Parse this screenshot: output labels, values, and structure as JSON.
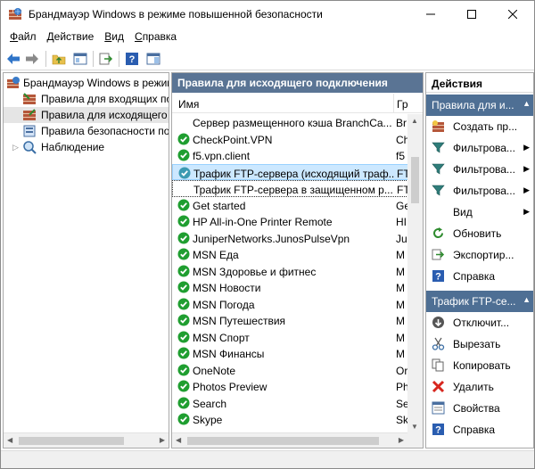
{
  "window": {
    "title": "Брандмауэр Windows в режиме повышенной безопасности"
  },
  "menu": [
    {
      "label": "Файл",
      "hotkey": "Ф",
      "rest": "айл"
    },
    {
      "label": "Действие",
      "hotkey": "Д",
      "rest": "ействие"
    },
    {
      "label": "Вид",
      "hotkey": "В",
      "rest": "ид"
    },
    {
      "label": "Справка",
      "hotkey": "С",
      "rest": "правка"
    }
  ],
  "tree": {
    "root": "Брандмауэр Windows в режиме повышенной безопасности",
    "items": [
      {
        "label": "Правила для входящих подключений"
      },
      {
        "label": "Правила для исходящего подключения"
      },
      {
        "label": "Правила безопасности подключения"
      },
      {
        "label": "Наблюдение"
      }
    ]
  },
  "middle": {
    "header": "Правила для исходящего подключения",
    "col_name": "Имя",
    "col_group": "Гр",
    "rules": [
      {
        "name": "Сервер размещенного кэша BranchCa...",
        "group": "Br",
        "status": "none"
      },
      {
        "name": "CheckPoint.VPN",
        "group": "Ch",
        "status": "enabled"
      },
      {
        "name": "f5.vpn.client",
        "group": "f5",
        "status": "enabled"
      },
      {
        "name": "Трафик FTP-сервера (исходящий траф...",
        "group": "FT",
        "status": "selected"
      },
      {
        "name": "Трафик FTP-сервера в защищенном р...",
        "group": "FT",
        "status": "none"
      },
      {
        "name": "Get started",
        "group": "Ge",
        "status": "enabled"
      },
      {
        "name": "HP All-in-One Printer Remote",
        "group": "HI",
        "status": "enabled"
      },
      {
        "name": "JuniperNetworks.JunosPulseVpn",
        "group": "Ju",
        "status": "enabled"
      },
      {
        "name": "MSN Еда",
        "group": "M",
        "status": "enabled"
      },
      {
        "name": "MSN Здоровье и фитнес",
        "group": "M",
        "status": "enabled"
      },
      {
        "name": "MSN Новости",
        "group": "M",
        "status": "enabled"
      },
      {
        "name": "MSN Погода",
        "group": "M",
        "status": "enabled"
      },
      {
        "name": "MSN Путешествия",
        "group": "M",
        "status": "enabled"
      },
      {
        "name": "MSN Спорт",
        "group": "M",
        "status": "enabled"
      },
      {
        "name": "MSN Финансы",
        "group": "M",
        "status": "enabled"
      },
      {
        "name": "OneNote",
        "group": "Or",
        "status": "enabled"
      },
      {
        "name": "Photos Preview",
        "group": "Ph",
        "status": "enabled"
      },
      {
        "name": "Search",
        "group": "Se",
        "status": "enabled"
      },
      {
        "name": "Skype",
        "group": "Sk",
        "status": "enabled"
      }
    ]
  },
  "actions": {
    "header": "Действия",
    "section1": "Правила для и...",
    "items1": [
      {
        "label": "Создать пр...",
        "icon": "new-rule-icon",
        "submenu": false
      },
      {
        "label": "Фильтрова...",
        "icon": "filter-icon",
        "submenu": true
      },
      {
        "label": "Фильтрова...",
        "icon": "filter-icon",
        "submenu": true
      },
      {
        "label": "Фильтрова...",
        "icon": "filter-icon",
        "submenu": true
      },
      {
        "label": "Вид",
        "icon": "",
        "submenu": true
      },
      {
        "label": "Обновить",
        "icon": "refresh-icon",
        "submenu": false
      },
      {
        "label": "Экспортир...",
        "icon": "export-icon",
        "submenu": false
      },
      {
        "label": "Справка",
        "icon": "help-icon",
        "submenu": false
      }
    ],
    "section2": "Трафик FTP-се...",
    "items2": [
      {
        "label": "Отключит...",
        "icon": "disable-icon"
      },
      {
        "label": "Вырезать",
        "icon": "cut-icon"
      },
      {
        "label": "Копировать",
        "icon": "copy-icon"
      },
      {
        "label": "Удалить",
        "icon": "delete-icon"
      },
      {
        "label": "Свойства",
        "icon": "properties-icon"
      },
      {
        "label": "Справка",
        "icon": "help-icon"
      }
    ]
  },
  "colors": {
    "header_blue": "#5a7494",
    "section_blue": "#4e6f94",
    "enabled_green": "#1f9e30",
    "selection": "#cce8ff"
  }
}
